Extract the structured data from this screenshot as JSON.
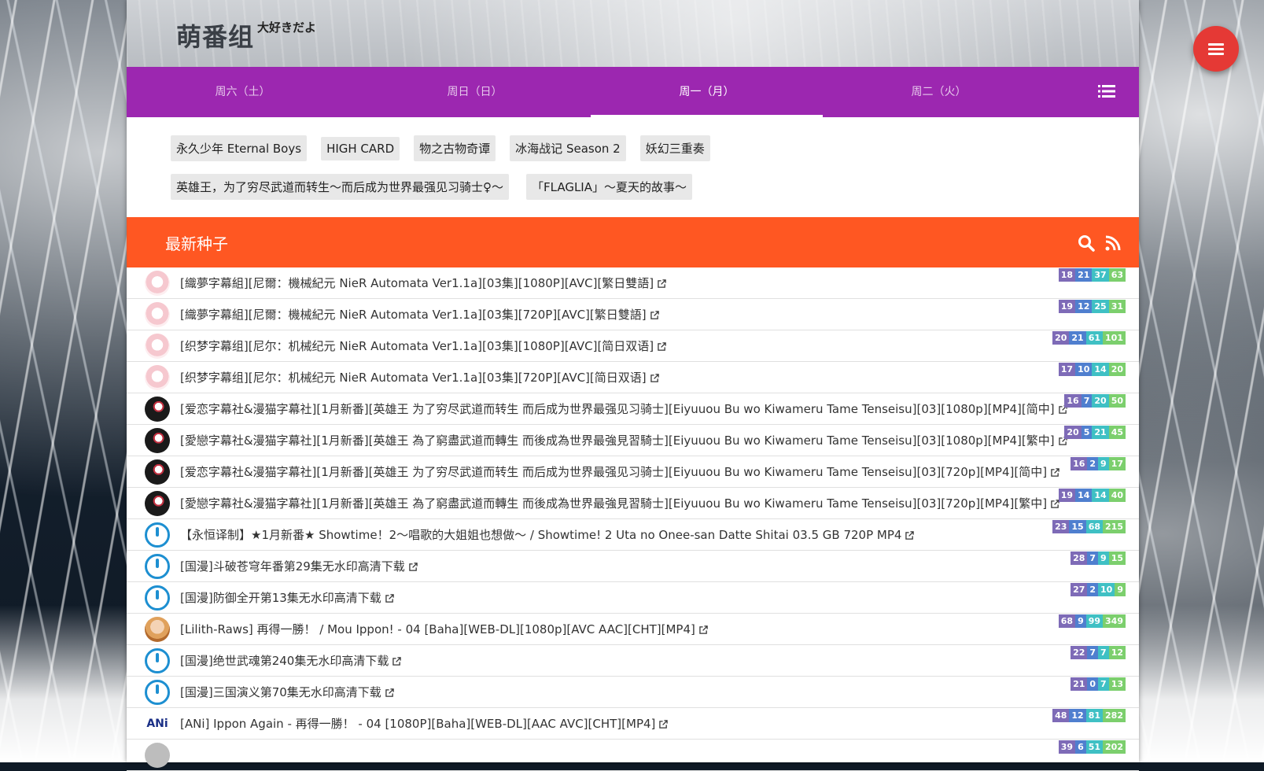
{
  "header": {
    "brand": "萌番组",
    "brand_sub": "大好きだよ"
  },
  "day_tabs": [
    {
      "label": "周六（土）",
      "active": false
    },
    {
      "label": "周日（日）",
      "active": false
    },
    {
      "label": "周一（月）",
      "active": true
    },
    {
      "label": "周二（火）",
      "active": false
    }
  ],
  "bangumi": [
    "永久少年 Eternal Boys",
    "HIGH CARD",
    "物之古物奇谭",
    "冰海战记 Season 2",
    "妖幻三重奏",
    "英雄王，为了穷尽武道而转生～而后成为世界最强见习骑士♀～",
    "「FLAGLIA」～夏天的故事～"
  ],
  "torrents": {
    "title": "最新种子",
    "rows": [
      {
        "title": "[織夢字幕組][尼爾：機械紀元 NieR Automata Ver1.1a][03集][1080P][AVC][繁日雙語]",
        "stats": [
          "18",
          "21",
          "37",
          "63"
        ]
      },
      {
        "title": "[織夢字幕組][尼爾：機械紀元 NieR Automata Ver1.1a][03集][720P][AVC][繁日雙語]",
        "stats": [
          "19",
          "12",
          "25",
          "31"
        ]
      },
      {
        "title": "[织梦字幕组][尼尔：机械纪元 NieR Automata Ver1.1a][03集][1080P][AVC][简日双语]",
        "stats": [
          "20",
          "21",
          "61",
          "101"
        ]
      },
      {
        "title": "[织梦字幕组][尼尔：机械纪元 NieR Automata Ver1.1a][03集][720P][AVC][简日双语]",
        "stats": [
          "17",
          "10",
          "14",
          "20"
        ]
      },
      {
        "title": "[爱恋字幕社&漫猫字幕社][1月新番][英雄王 为了穷尽武道而转生 而后成为世界最强见习骑士][Eiyuuou Bu wo Kiwameru Tame Tenseisu][03][1080p][MP4][简中]",
        "stats": [
          "16",
          "7",
          "20",
          "50"
        ]
      },
      {
        "title": "[愛戀字幕社&漫猫字幕社][1月新番][英雄王 為了窮盡武道而轉生 而後成為世界最強見習騎士][Eiyuuou Bu wo Kiwameru Tame Tenseisu][03][1080p][MP4][繁中]",
        "stats": [
          "20",
          "5",
          "21",
          "45"
        ]
      },
      {
        "title": "[爱恋字幕社&漫猫字幕社][1月新番][英雄王 为了穷尽武道而转生 而后成为世界最强见习骑士][Eiyuuou Bu wo Kiwameru Tame Tenseisu][03][720p][MP4][简中]",
        "stats": [
          "16",
          "2",
          "9",
          "17"
        ]
      },
      {
        "title": "[愛戀字幕社&漫猫字幕社][1月新番][英雄王 為了窮盡武道而轉生 而後成為世界最強見習騎士][Eiyuuou Bu wo Kiwameru Tame Tenseisu][03][720p][MP4][繁中]",
        "stats": [
          "19",
          "14",
          "14",
          "40"
        ]
      },
      {
        "title": "【永恒译制】★1月新番★ Showtime！2～唱歌的大姐姐也想做～ / Showtime! 2 Uta no Onee-san Datte Shitai 03.5 GB 720P MP4",
        "stats": [
          "23",
          "15",
          "68",
          "215"
        ]
      },
      {
        "title": "[国漫]斗破苍穹年番第29集无水印高清下载",
        "stats": [
          "28",
          "7",
          "9",
          "15"
        ]
      },
      {
        "title": "[国漫]防御全开第13集无水印高清下载",
        "stats": [
          "27",
          "2",
          "10",
          "9"
        ]
      },
      {
        "title": "[Lilith-Raws] 再得一勝！ / Mou Ippon! - 04 [Baha][WEB-DL][1080p][AVC AAC][CHT][MP4]",
        "stats": [
          "68",
          "9",
          "99",
          "349"
        ]
      },
      {
        "title": "[国漫]绝世武魂第240集无水印高清下载",
        "stats": [
          "22",
          "7",
          "7",
          "12"
        ]
      },
      {
        "title": "[国漫]三国演义第70集无水印高清下载",
        "stats": [
          "21",
          "0",
          "7",
          "13"
        ]
      },
      {
        "title": "[ANi] Ippon Again - 再得一勝！ - 04 [1080P][Baha][WEB-DL][AAC AVC][CHT][MP4]",
        "stats": [
          "48",
          "12",
          "81",
          "282"
        ]
      },
      {
        "title": "",
        "stats": [
          "39",
          "6",
          "51",
          "202"
        ]
      }
    ]
  },
  "ani_logo_text": "ANi",
  "colors": {
    "purple": "#9c27b0",
    "orange": "#ff5722",
    "fab_red": "#e53935"
  }
}
